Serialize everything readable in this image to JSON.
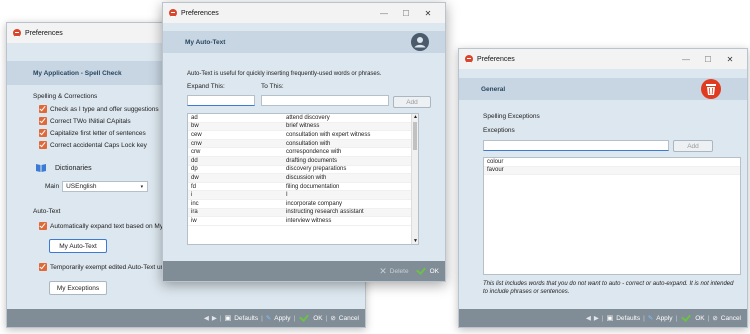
{
  "window1": {
    "title": "Preferences",
    "header": "My Application - Spell Check",
    "section_spelling": "Spelling & Corrections",
    "options": [
      "Check as I type and offer suggestions",
      "Correct TWo INitial CApitals",
      "Capitalize first letter of sentences",
      "Correct accidental Caps Lock key"
    ],
    "dictionaries_label": "Dictionaries",
    "main_label": "Main",
    "main_value": "USEnglish",
    "section_autotext": "Auto-Text",
    "auto_expand": "Automatically expand text based on My Au",
    "my_autotext_button": "My Auto-Text",
    "temp_exempt": "Temporarily exempt edited Auto-Text until",
    "my_exceptions_button": "My Exceptions"
  },
  "footer": {
    "defaults": "Defaults",
    "apply": "Apply",
    "ok": "OK",
    "cancel": "Cancel"
  },
  "window2": {
    "title": "Preferences",
    "header": "My Auto-Text",
    "description": "Auto-Text is useful for quickly inserting frequently-used words or phrases.",
    "expand_label": "Expand This:",
    "to_label": "To This:",
    "add_button": "Add",
    "entries": [
      [
        "ad",
        "attend discovery"
      ],
      [
        "bw",
        "brief witness"
      ],
      [
        "cew",
        "consultation with expert witness"
      ],
      [
        "cnw",
        "consultation with"
      ],
      [
        "crw",
        "correspondence with"
      ],
      [
        "dd",
        "drafting documents"
      ],
      [
        "dp",
        "discovery preparations"
      ],
      [
        "dw",
        "discussion with"
      ],
      [
        "fd",
        "filing documentation"
      ],
      [
        "i",
        "I"
      ],
      [
        "inc",
        "incorporate company"
      ],
      [
        "ira",
        "instructing research assistant"
      ],
      [
        "iw",
        "interview witness"
      ]
    ],
    "delete_label": "Delete",
    "ok_label": "OK"
  },
  "window3": {
    "title": "Preferences",
    "header": "General",
    "section": "Spelling Exceptions",
    "exceptions_label": "Exceptions",
    "add_button": "Add",
    "items": [
      "colour",
      "favour"
    ],
    "note": "This list includes words that you do not want to auto - correct or auto-expand. It is not intended to include phrases or sentences."
  },
  "colors": {
    "accent": "#e0693a",
    "header_bg": "#c8d6e3",
    "window_bg": "#dde7ef",
    "footer_bg": "#808c96",
    "ok_green": "#6ac244",
    "focus_blue": "#3b7bd6"
  }
}
